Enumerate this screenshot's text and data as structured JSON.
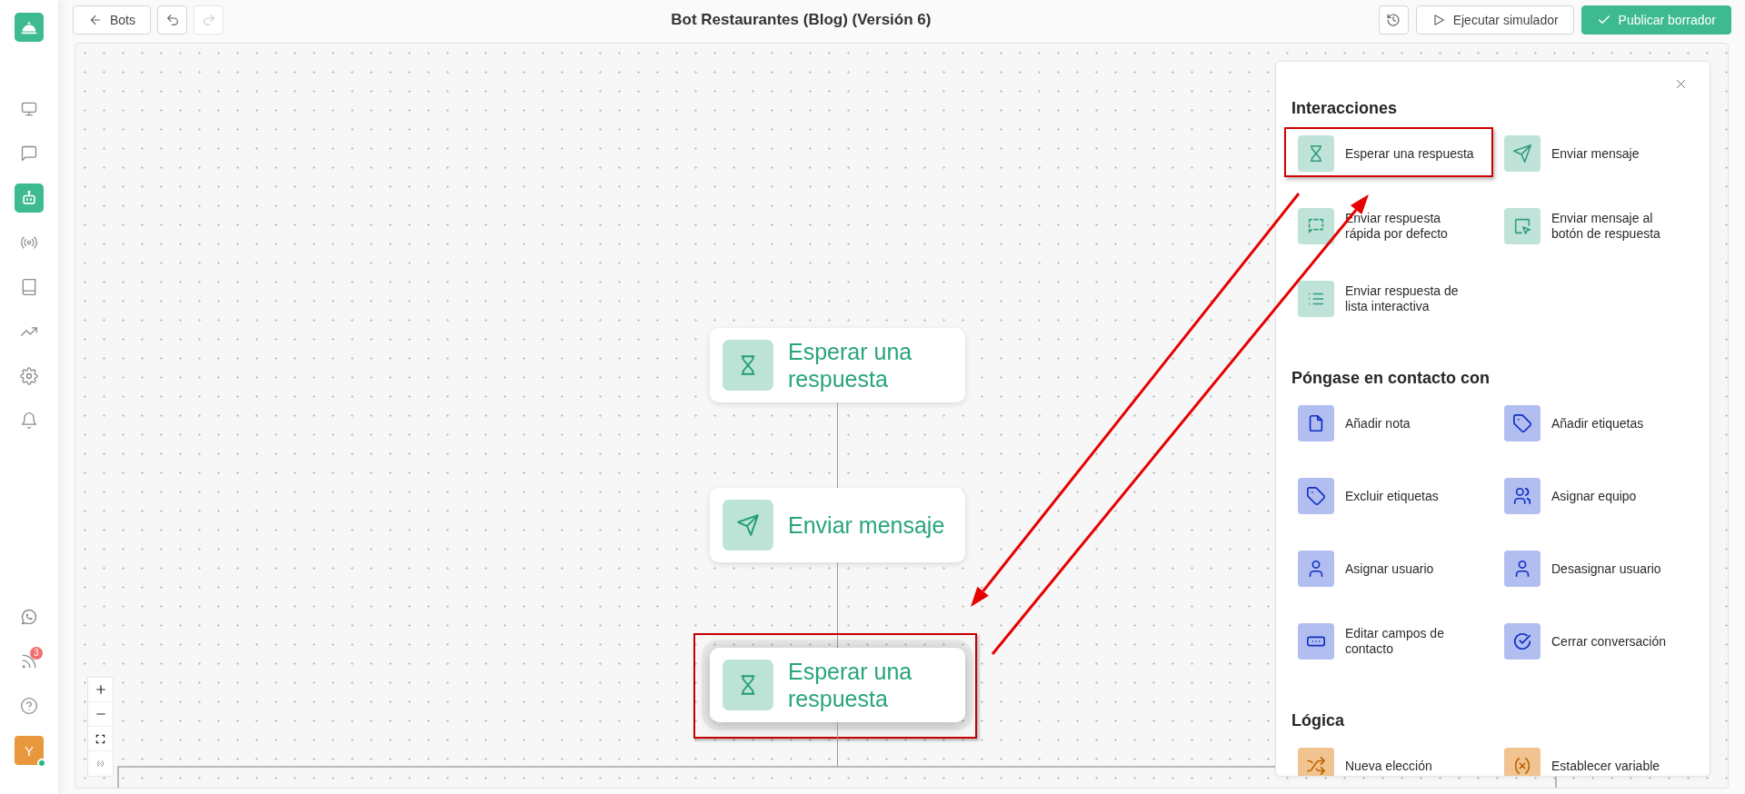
{
  "sidebar": {
    "nav": [
      {
        "kind": "monitor",
        "selected": false
      },
      {
        "kind": "chat",
        "selected": false
      },
      {
        "kind": "bot",
        "selected": true
      },
      {
        "kind": "broadcast",
        "selected": false
      },
      {
        "kind": "book",
        "selected": false
      },
      {
        "kind": "trend",
        "selected": false
      },
      {
        "kind": "settings",
        "selected": false
      },
      {
        "kind": "bell",
        "selected": false
      }
    ],
    "bottom": [
      {
        "kind": "whatsapp"
      },
      {
        "kind": "feed",
        "badge": "3"
      },
      {
        "kind": "help"
      }
    ],
    "avatar": {
      "initial": "Y",
      "online": true
    }
  },
  "toolbar": {
    "back": "Bots",
    "undo": {
      "disabled": false
    },
    "redo": {
      "disabled": true
    },
    "title": "Bot Restaurantes (Blog) (Versión 6)",
    "actions": [
      {
        "label": "Ejecutar simulador",
        "kind": "secondary"
      },
      {
        "label": "Publicar borrador",
        "kind": "primary"
      }
    ]
  },
  "canvas": {
    "nodes": [
      {
        "label": "Esperar una respuesta",
        "kind": "wait",
        "selected": false,
        "highlighted": false
      },
      {
        "label": "Enviar mensaje",
        "kind": "send",
        "selected": false,
        "highlighted": false
      },
      {
        "label": "Esperar una respuesta",
        "kind": "wait",
        "selected": true,
        "highlighted": true
      }
    ]
  },
  "panel": {
    "sections": [
      {
        "title": "Interacciones",
        "color": "#bfe3d8",
        "items": [
          {
            "label": "Esperar una respuesta",
            "kind": "wait",
            "highlighted": true
          },
          {
            "label": "Enviar mensaje",
            "kind": "send",
            "highlighted": false
          },
          {
            "label": "Enviar respuesta rápida por defecto",
            "kind": "quickreply",
            "highlighted": false
          },
          {
            "label": "Enviar mensaje al botón de respuesta",
            "kind": "buttonreply",
            "highlighted": false
          },
          {
            "label": "Enviar respuesta de lista interactiva",
            "kind": "list",
            "highlighted": false
          }
        ]
      },
      {
        "title": "Póngase en contacto con",
        "color": "#b3bef0",
        "items": [
          {
            "label": "Añadir nota",
            "kind": "note",
            "highlighted": false
          },
          {
            "label": "Añadir etiquetas",
            "kind": "addtag",
            "highlighted": false
          },
          {
            "label": "Excluir etiquetas",
            "kind": "removetag",
            "highlighted": false
          },
          {
            "label": "Asignar equipo",
            "kind": "team",
            "highlighted": false
          },
          {
            "label": "Asignar usuario",
            "kind": "assign",
            "highlighted": false
          },
          {
            "label": "Desasignar usuario",
            "kind": "unassign",
            "highlighted": false
          },
          {
            "label": "Editar campos de contacto",
            "kind": "fields",
            "highlighted": false
          },
          {
            "label": "Cerrar conversación",
            "kind": "close",
            "highlighted": false
          }
        ]
      },
      {
        "title": "Lógica",
        "color": "#f0c390",
        "items": [
          {
            "label": "Nueva elección",
            "kind": "choice",
            "highlighted": false
          },
          {
            "label": "Establecer variable",
            "kind": "variable",
            "highlighted": false
          }
        ]
      }
    ]
  }
}
